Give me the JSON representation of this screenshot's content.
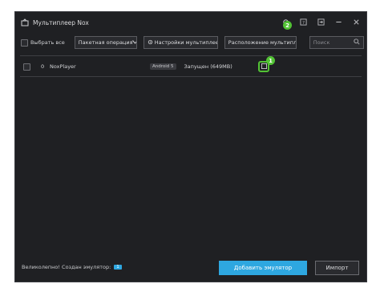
{
  "window": {
    "title": "Мультиплеер Nox"
  },
  "toolbar": {
    "select_all_label": "Выбрать все",
    "batch_label": "Пакетная операция",
    "settings_label": "Настройки мультиплеер",
    "layout_label": "Расположение мультипле",
    "search_placeholder": "Поиск"
  },
  "instances": [
    {
      "index": "0",
      "name": "NoxPlayer",
      "android": "Android 5",
      "status": "Запущен (649MB)"
    }
  ],
  "callouts": {
    "one": "1",
    "two": "2"
  },
  "footer": {
    "message": "Великолепно! Создан эмулятор:",
    "count": "1",
    "add_label": "Добавить эмулятор",
    "import_label": "Импорт"
  },
  "colors": {
    "accent": "#2ea7e0",
    "callout": "#52c234",
    "background": "#1f2023"
  },
  "icons": [
    "app-icon",
    "settings-icon",
    "help-icon",
    "export-icon",
    "minimize-icon",
    "close-icon",
    "search-icon",
    "dropdown-icon",
    "instance-action-icon"
  ]
}
